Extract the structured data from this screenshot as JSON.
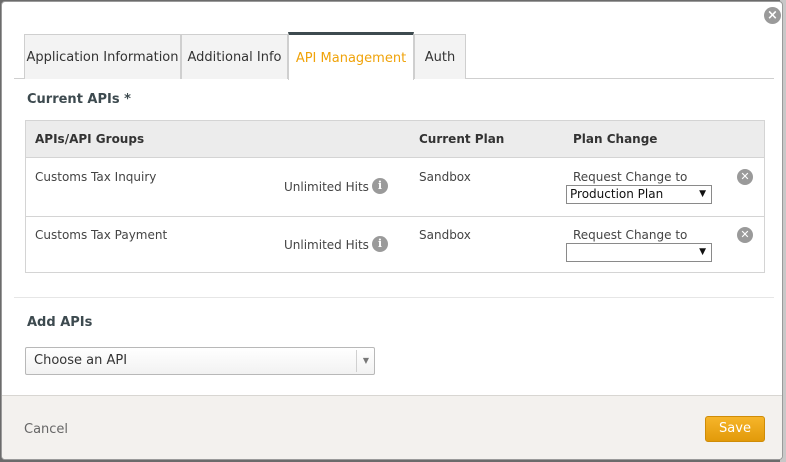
{
  "close_label": "×",
  "tabs": [
    {
      "label": "Application Information"
    },
    {
      "label": "Additional Info"
    },
    {
      "label": "API Management"
    },
    {
      "label": "Auth"
    }
  ],
  "active_tab": "API Management",
  "current_apis": {
    "title": "Current APIs *",
    "columns": [
      "APIs/API Groups",
      "Current Plan",
      "Plan Change"
    ],
    "rows": [
      {
        "name": "Customs Tax Inquiry",
        "hits": "Unlimited Hits",
        "current_plan": "Sandbox",
        "change_label": "Request Change to",
        "change_value": "Production Plan"
      },
      {
        "name": "Customs Tax Payment",
        "hits": "Unlimited Hits",
        "current_plan": "Sandbox",
        "change_label": "Request Change to",
        "change_value": ""
      }
    ]
  },
  "add_apis": {
    "title": "Add APIs",
    "select_value": "Choose an API"
  },
  "footer": {
    "cancel_label": "Cancel",
    "save_label": "Save"
  },
  "icons": {
    "info": "info-icon",
    "remove": "close-circle-icon",
    "dropdown": "chevron-down-icon"
  },
  "colors": {
    "accent": "#f0a30a",
    "save_button": "#eea617",
    "tab_active_border": "#3d4a4f",
    "header_bg": "#ececec"
  }
}
